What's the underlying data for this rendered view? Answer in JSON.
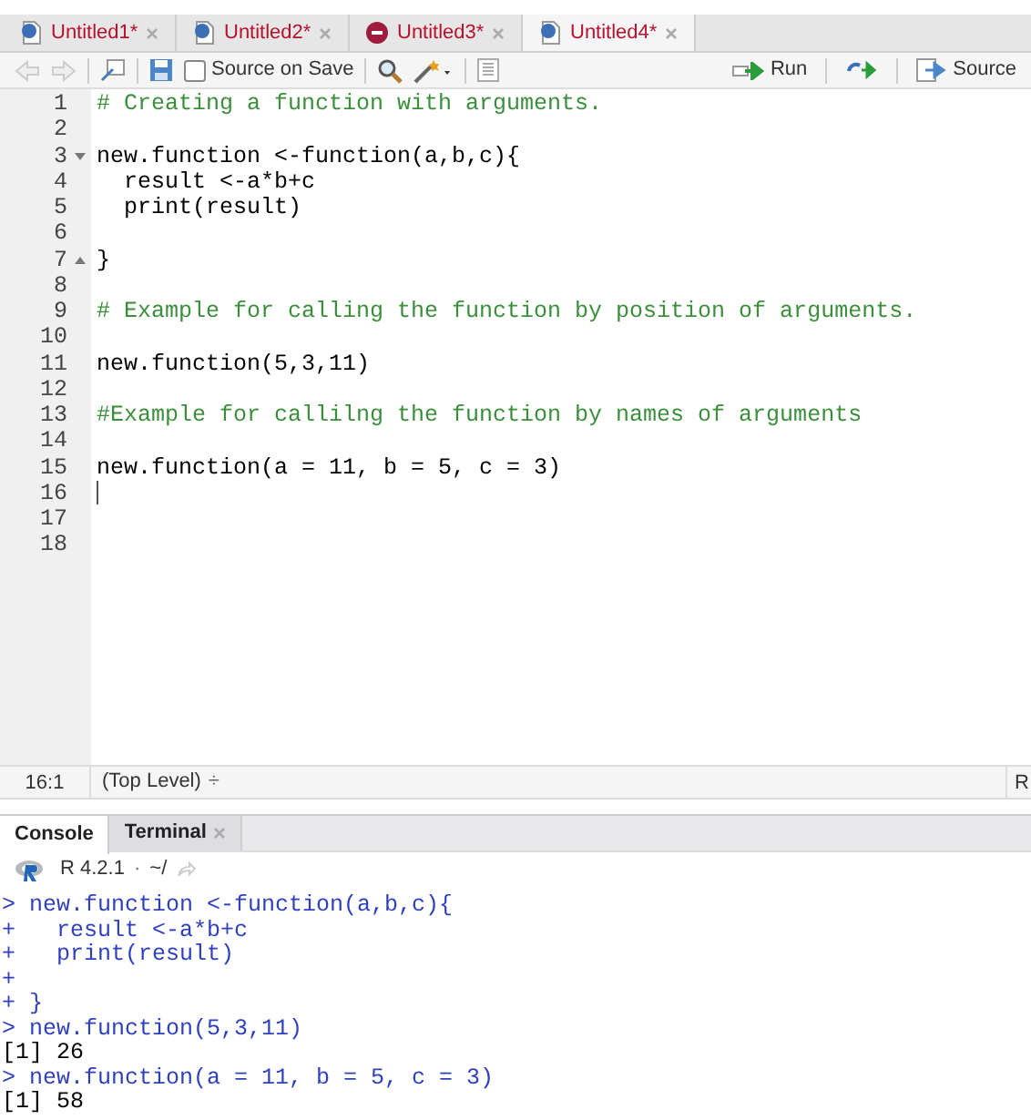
{
  "editor_tabs": [
    {
      "label": "Untitled1*",
      "kind": "script",
      "selected": false
    },
    {
      "label": "Untitled2*",
      "kind": "script",
      "selected": false
    },
    {
      "label": "Untitled3*",
      "kind": "markdown",
      "selected": false
    },
    {
      "label": "Untitled4*",
      "kind": "script",
      "selected": true
    }
  ],
  "toolbar": {
    "source_on_save": {
      "label": "Source on Save",
      "checked": false
    },
    "run": "Run",
    "source": "Source"
  },
  "code_lines": [
    {
      "number": "1",
      "kind": "comment",
      "text": "# Creating a function with arguments."
    },
    {
      "number": "2",
      "kind": "blank"
    },
    {
      "number": "3",
      "kind": "code",
      "text": "new.function <-function(a,b,c){",
      "fold_start": true
    },
    {
      "number": "4",
      "kind": "code",
      "text": "  result <-a*b+c"
    },
    {
      "number": "5",
      "kind": "code",
      "text": "  print(result)"
    },
    {
      "number": "6",
      "kind": "blank"
    },
    {
      "number": "7",
      "kind": "code",
      "text": "}",
      "fold_end": true
    },
    {
      "number": "8",
      "kind": "blank"
    },
    {
      "number": "9",
      "kind": "comment",
      "text": "# Example for calling the function by position of arguments."
    },
    {
      "number": "10",
      "kind": "blank"
    },
    {
      "number": "11",
      "kind": "code",
      "text": "new.function(5,3,11)"
    },
    {
      "number": "12",
      "kind": "blank"
    },
    {
      "number": "13",
      "kind": "comment",
      "text": "#Example for callilng the function by names of arguments"
    },
    {
      "number": "14",
      "kind": "blank"
    },
    {
      "number": "15",
      "kind": "code",
      "text": "new.function(a = 11, b = 5, c = 3)"
    },
    {
      "number": "16",
      "kind": "blank",
      "cursor": true
    },
    {
      "number": "17",
      "kind": "blank"
    },
    {
      "number": "18",
      "kind": "blank"
    }
  ],
  "status_bar": {
    "position": "16:1",
    "scope": "(Top Level)",
    "scope_arrows": "÷",
    "file_type": "R"
  },
  "console_tabs": [
    {
      "label": "Console",
      "selected": true,
      "closable": false
    },
    {
      "label": "Terminal",
      "selected": false,
      "closable": true
    }
  ],
  "console_header": {
    "version": "R 4.2.1",
    "separator": "·",
    "path": "~/"
  },
  "console_lines": [
    {
      "kind": "input",
      "prompt": ">",
      "text": "new.function <-function(a,b,c){"
    },
    {
      "kind": "input",
      "prompt": "+",
      "text": "  result <-a*b+c"
    },
    {
      "kind": "input",
      "prompt": "+",
      "text": "  print(result)"
    },
    {
      "kind": "input",
      "prompt": "+"
    },
    {
      "kind": "input",
      "prompt": "+",
      "text": "}"
    },
    {
      "kind": "input",
      "prompt": ">",
      "text": "new.function(5,3,11)"
    },
    {
      "kind": "output",
      "text": "[1] 26"
    },
    {
      "kind": "input",
      "prompt": ">",
      "text": "new.function(a = 11, b = 5, c = 3)"
    },
    {
      "kind": "output",
      "text": "[1] 58"
    }
  ]
}
